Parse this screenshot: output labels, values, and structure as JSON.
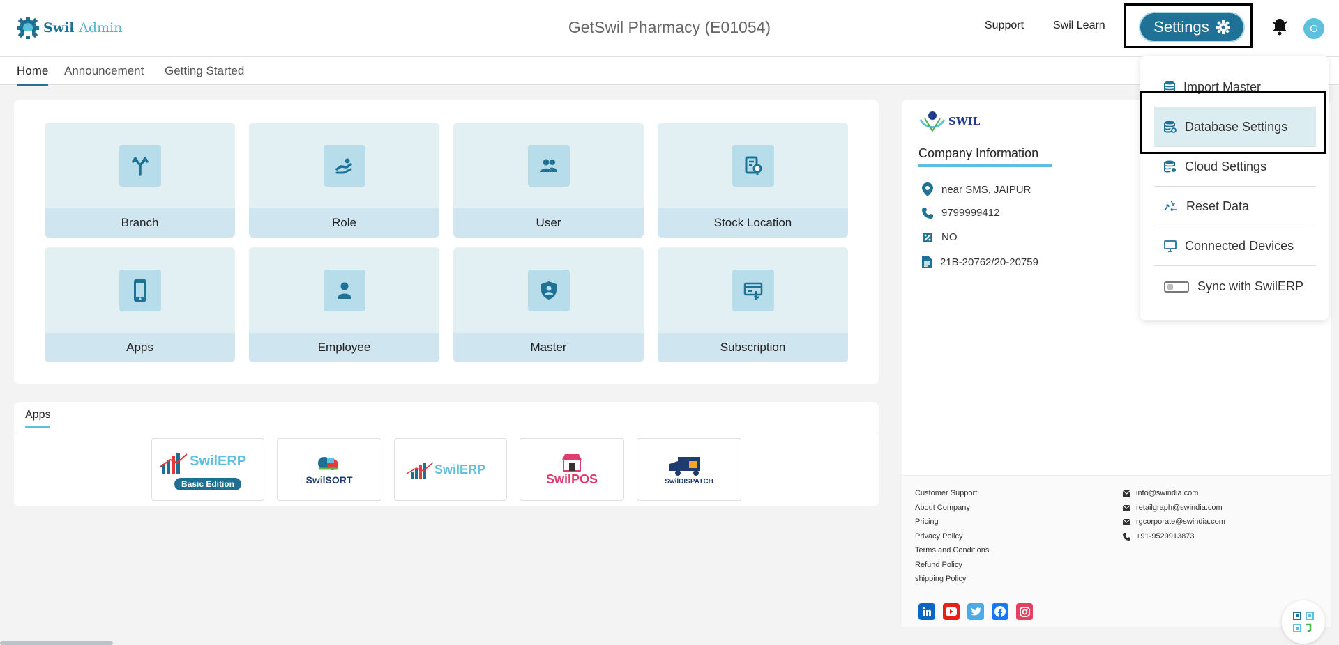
{
  "header": {
    "logo_word1": "Swil",
    "logo_word2": "Admin",
    "company_title": "GetSwil Pharmacy (E01054)",
    "support": "Support",
    "learn": "Swil Learn",
    "settings": "Settings",
    "avatar_initial": "G"
  },
  "tabs": [
    "Home",
    "Announcement",
    "Getting Started"
  ],
  "tiles": [
    {
      "label": "Branch",
      "icon": "branch-icon"
    },
    {
      "label": "Role",
      "icon": "role-icon"
    },
    {
      "label": "User",
      "icon": "users-icon"
    },
    {
      "label": "Stock Location",
      "icon": "stock-location-icon"
    },
    {
      "label": "Apps",
      "icon": "mobile-icon"
    },
    {
      "label": "Employee",
      "icon": "employee-icon"
    },
    {
      "label": "Master",
      "icon": "shield-user-icon"
    },
    {
      "label": "Subscription",
      "icon": "subscription-icon"
    }
  ],
  "apps": {
    "tab": "Apps",
    "items": [
      {
        "name": "SwilERP",
        "badge": "Basic Edition"
      },
      {
        "name": "SwilSORT"
      },
      {
        "name": "SwilERP"
      },
      {
        "name": "SwilPOS"
      },
      {
        "name": "SwilDISPATCH"
      }
    ]
  },
  "company": {
    "logo_text": "SWIL",
    "heading": "Company Information",
    "address": "near SMS, JAIPUR",
    "phone": "9799999412",
    "gst": "NO",
    "license": "21B-20762/20-20759"
  },
  "footer": {
    "links": [
      "Customer Support",
      "About Company",
      "Pricing",
      "Privacy Policy",
      "Terms and Conditions",
      "Refund Policy",
      "shipping Policy"
    ],
    "contacts": [
      {
        "icon": "mail-icon",
        "text": "info@swindia.com"
      },
      {
        "icon": "mail-icon",
        "text": "retailgraph@swindia.com"
      },
      {
        "icon": "mail-icon",
        "text": "rgcorporate@swindia.com"
      },
      {
        "icon": "phone-icon",
        "text": "+91-9529913873"
      }
    ],
    "social": [
      {
        "icon": "linkedin-icon",
        "color": "#0a66c2"
      },
      {
        "icon": "youtube-icon",
        "color": "#e62117"
      },
      {
        "icon": "twitter-icon",
        "color": "#4ea9e6"
      },
      {
        "icon": "facebook-icon",
        "color": "#1877f2"
      },
      {
        "icon": "instagram-icon",
        "color": "#e4405f"
      }
    ]
  },
  "dropdown": {
    "items": [
      "Import Master",
      "Database Settings",
      "Cloud Settings",
      "Reset Data",
      "Connected Devices"
    ],
    "sync_label": "Sync with SwilERP",
    "highlighted": "Database Settings"
  },
  "colors": {
    "primary": "#1f7295",
    "accent": "#5ec0dc",
    "tile_bg": "#e2f0f4"
  }
}
